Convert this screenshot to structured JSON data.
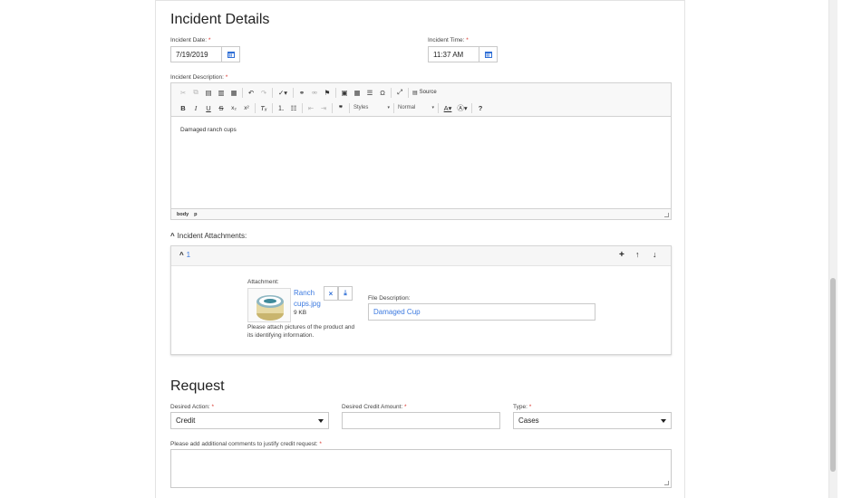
{
  "incident": {
    "title": "Incident Details",
    "date_label": "Incident Date:",
    "date_value": "7/19/2019",
    "time_label": "Incident Time:",
    "time_value": "11:37 AM",
    "required_mark": "*",
    "description_label": "Incident Description:",
    "description_text": "Damaged ranch cups",
    "editor_path": [
      "body",
      "p"
    ],
    "toolbar": {
      "source_label": "Source",
      "styles_label": "Styles",
      "format_label": "Normal"
    }
  },
  "attachments": {
    "header_label": "Incident Attachments:",
    "item_index": "1",
    "attachment_label": "Attachment:",
    "file_name_line1": "Ranch",
    "file_name_line2": "cups.jpg",
    "file_size": "9 KB",
    "help_text_line1": "Please attach pictures of the product and",
    "help_text_line2": "its identifying information.",
    "file_description_label": "File Description:",
    "file_description_value": "Damaged Cup"
  },
  "request": {
    "title": "Request",
    "desired_action_label": "Desired Action:",
    "desired_action_value": "Credit",
    "credit_amount_label": "Desired Credit Amount:",
    "credit_amount_value": "",
    "type_label": "Type:",
    "type_value": "Cases",
    "comments_label": "Please add additional comments to justify credit request:",
    "comments_value": ""
  },
  "colors": {
    "accent": "#3c7ae0",
    "required": "#d9342b"
  }
}
